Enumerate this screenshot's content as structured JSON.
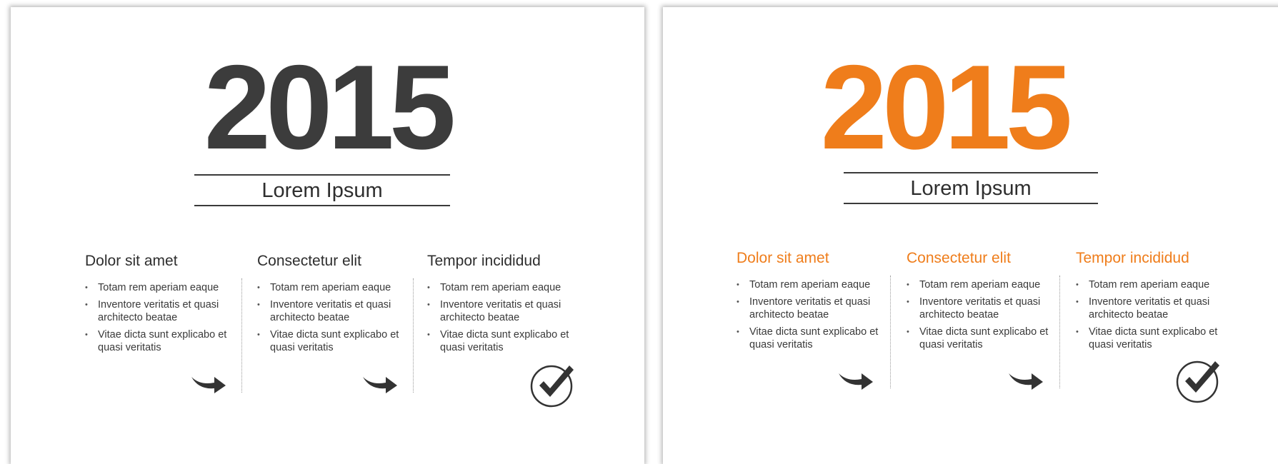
{
  "slides": [
    {
      "year": "2015",
      "subtitle": "Lorem Ipsum",
      "accent_color": "#3c3c3c",
      "columns": [
        {
          "heading": "Dolor sit amet",
          "bullets": [
            "Totam rem aperiam eaque",
            "Inventore veritatis et quasi architecto beatae",
            "Vitae dicta sunt explicabo et quasi veritatis"
          ],
          "icon": "arrow-icon"
        },
        {
          "heading": "Consectetur elit",
          "bullets": [
            "Totam rem aperiam eaque",
            "Inventore veritatis et quasi architecto beatae",
            "Vitae dicta sunt explicabo et quasi veritatis"
          ],
          "icon": "arrow-icon"
        },
        {
          "heading": "Tempor incididud",
          "bullets": [
            "Totam rem aperiam eaque",
            "Inventore veritatis et quasi architecto beatae",
            "Vitae dicta sunt explicabo et quasi veritatis"
          ],
          "icon": "check-circle-icon"
        }
      ]
    },
    {
      "year": "2015",
      "subtitle": "Lorem Ipsum",
      "accent_color": "#ef7d1b",
      "columns": [
        {
          "heading": "Dolor sit amet",
          "bullets": [
            "Totam rem aperiam eaque",
            "Inventore veritatis et quasi architecto beatae",
            "Vitae dicta sunt explicabo et quasi veritatis"
          ],
          "icon": "arrow-icon"
        },
        {
          "heading": "Consectetur elit",
          "bullets": [
            "Totam rem aperiam eaque",
            "Inventore veritatis et quasi architecto beatae",
            "Vitae dicta sunt explicabo et quasi veritatis"
          ],
          "icon": "arrow-icon"
        },
        {
          "heading": "Tempor incididud",
          "bullets": [
            "Totam rem aperiam eaque",
            "Inventore veritatis et quasi architecto beatae",
            "Vitae dicta sunt explicabo et quasi veritatis"
          ],
          "icon": "check-circle-icon"
        }
      ]
    }
  ],
  "colors": {
    "dark_text": "#3c3c3c",
    "orange": "#ef7d1b",
    "icon": "#333333"
  }
}
